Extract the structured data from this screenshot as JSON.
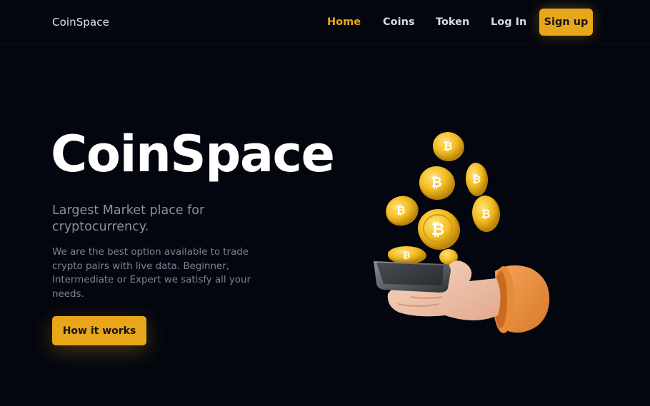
{
  "nav": {
    "brand": "CoinSpace",
    "links": [
      {
        "label": "Home",
        "active": true
      },
      {
        "label": "Coins",
        "active": false
      },
      {
        "label": "Token",
        "active": false
      },
      {
        "label": "Log In",
        "active": false
      }
    ],
    "signup_label": "Sign up"
  },
  "hero": {
    "title": "CoinSpace",
    "subtitle": "Largest Market place for cryptocurrency.",
    "description": "We are the best option available to trade crypto pairs with live data. Beginner, Intermediate or Expert we satisfy all your needs.",
    "cta_label": "How it works",
    "illustration_icon": "hand-holding-phone-with-bitcoins-icon"
  },
  "colors": {
    "background": "#03060f",
    "accent": "#e8a719",
    "muted_text": "#8b8f9f"
  }
}
